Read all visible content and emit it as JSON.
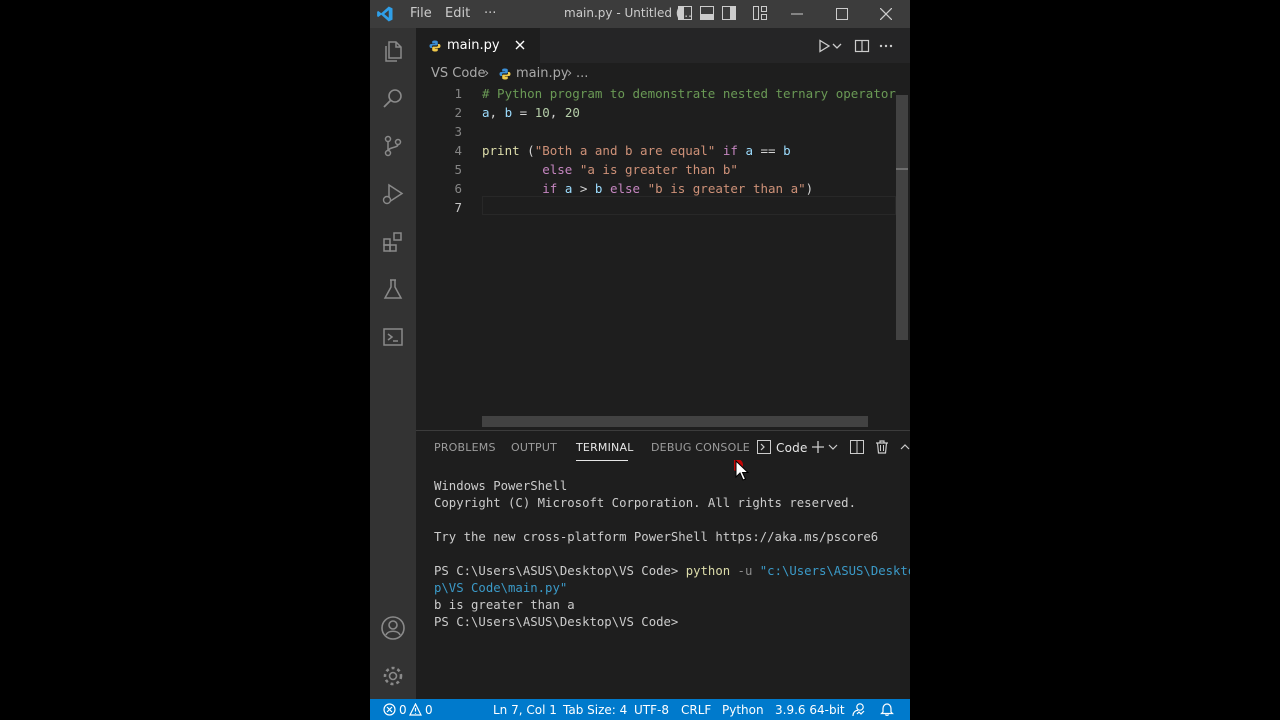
{
  "titlebar": {
    "menu": [
      "File",
      "Edit",
      "···"
    ],
    "title": "main.py - Untitled (..."
  },
  "tab": {
    "label": "main.py"
  },
  "breadcrumb": {
    "folder": "VS Code",
    "sep1": "›",
    "file": "main.py",
    "sep2": "›",
    "rest": "..."
  },
  "editor": {
    "line_numbers": [
      "1",
      "2",
      "3",
      "4",
      "5",
      "6",
      "7"
    ],
    "active_line": 7,
    "cursor": "Ln 7, Col 1"
  },
  "panel": {
    "tabs": [
      "PROBLEMS",
      "OUTPUT",
      "TERMINAL",
      "DEBUG CONSOLE"
    ],
    "active_tab": "TERMINAL",
    "terminal_name": "Code",
    "terminal_lines": [
      "Windows PowerShell",
      "Copyright (C) Microsoft Corporation. All rights reserved.",
      "",
      "Try the new cross-platform PowerShell https://aka.ms/pscore6",
      ""
    ],
    "prompt": "PS C:\\Users\\ASUS\\Desktop\\VS Code>",
    "cmd": "python",
    "flag": "-u",
    "arg_part1": "\"c:\\Users\\ASUS\\Deskto",
    "arg_part2": "p\\VS Code\\main.py\"",
    "output": "b is greater than a",
    "prompt2": "PS C:\\Users\\ASUS\\Desktop\\VS Code>"
  },
  "statusbar": {
    "errors": "0",
    "warnings": "0",
    "position": "Ln 7, Col 1",
    "tab_size": "Tab Size: 4",
    "encoding": "UTF-8",
    "eol": "CRLF",
    "language": "Python",
    "interpreter": "3.9.6 64-bit"
  },
  "colors": {
    "status_bar": "#007acc",
    "activity_bar": "#333333",
    "editor_bg": "#1e1e1e",
    "cursor_highlight": "#e00000"
  }
}
